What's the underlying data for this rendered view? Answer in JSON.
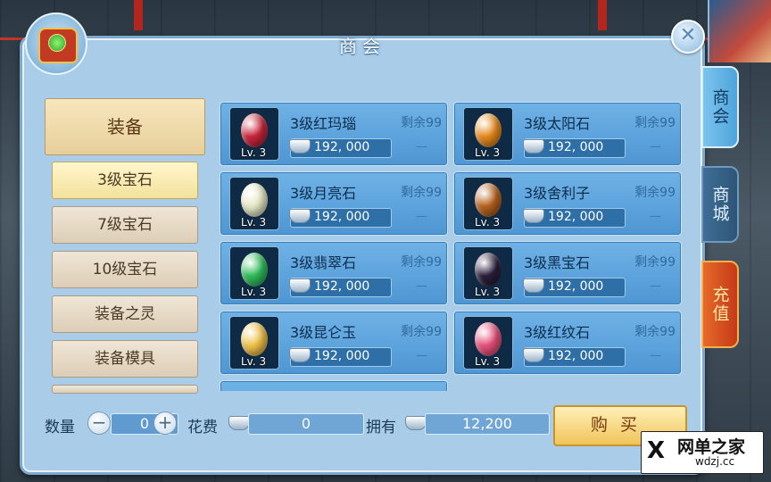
{
  "window": {
    "title": "商会"
  },
  "side_tabs": [
    "商会",
    "商城",
    "充值"
  ],
  "categories": {
    "main": "装备",
    "subs": [
      "3级宝石",
      "7级宝石",
      "10级宝石",
      "装备之灵",
      "装备模具"
    ],
    "active_index": 0
  },
  "items": [
    {
      "name": "3级红玛瑙",
      "level": "Lv. 3",
      "stock": "剩余99",
      "price": "192, 000",
      "color": "#c8253a"
    },
    {
      "name": "3级太阳石",
      "level": "Lv. 3",
      "stock": "剩余99",
      "price": "192, 000",
      "color": "#e68a1c"
    },
    {
      "name": "3级月亮石",
      "level": "Lv. 3",
      "stock": "剩余99",
      "price": "192, 000",
      "color": "#e7e9c6"
    },
    {
      "name": "3级舍利子",
      "level": "Lv. 3",
      "stock": "剩余99",
      "price": "192, 000",
      "color": "#b5611c"
    },
    {
      "name": "3级翡翠石",
      "level": "Lv. 3",
      "stock": "剩余99",
      "price": "192, 000",
      "color": "#2fbd5a"
    },
    {
      "name": "3级黑宝石",
      "level": "Lv. 3",
      "stock": "剩余99",
      "price": "192, 000",
      "color": "#2a1e3a"
    },
    {
      "name": "3级昆仑玉",
      "level": "Lv. 3",
      "stock": "剩余99",
      "price": "192, 000",
      "color": "#f0c24a"
    },
    {
      "name": "3级红纹石",
      "level": "Lv. 3",
      "stock": "剩余99",
      "price": "192, 000",
      "color": "#e6507a"
    }
  ],
  "item_dash": "—",
  "bottom": {
    "qty_label": "数量",
    "qty_minus": "−",
    "qty_value": "0",
    "qty_plus": "+",
    "cost_label": "花费",
    "cost_value": "0",
    "own_label": "拥有",
    "own_value": "12,200",
    "buy_label": "购买"
  },
  "watermark": {
    "logo": "Ⅹ",
    "text": "网单之家",
    "url": "wdzj.cc"
  },
  "colors": {
    "panel": "#a9cde9",
    "item": "#5aa0da",
    "buy": "#f0c45a"
  }
}
